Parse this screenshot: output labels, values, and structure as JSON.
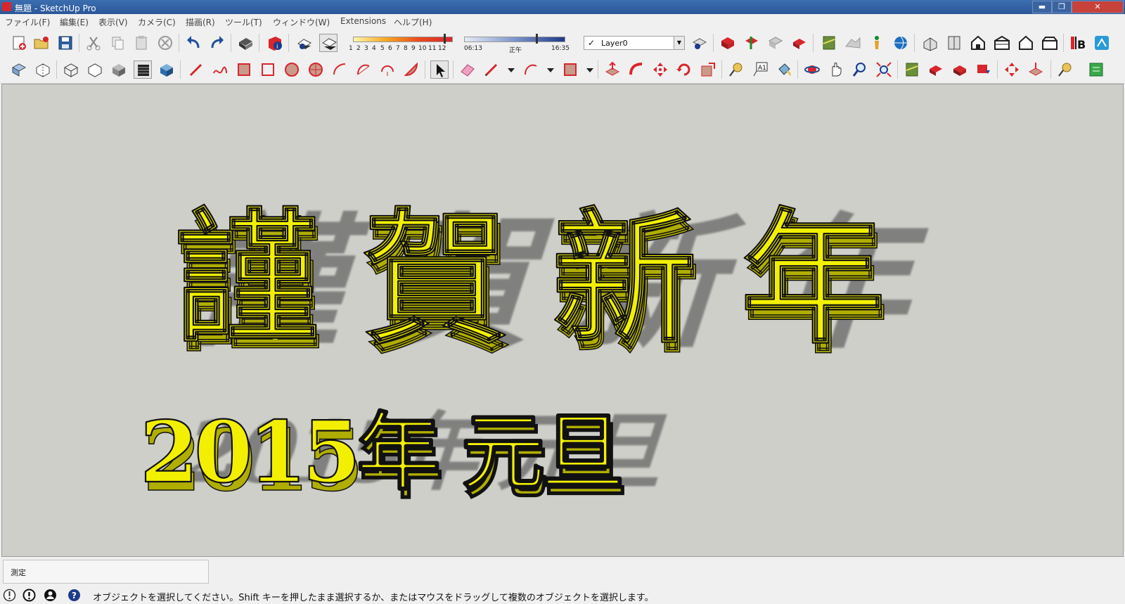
{
  "window": {
    "title": "無題 - SketchUp Pro",
    "controls": {
      "minimize": "▬",
      "restore": "❐",
      "close": "✕"
    }
  },
  "menubar": {
    "items": [
      "ファイル(F)",
      "編集(E)",
      "表示(V)",
      "カメラ(C)",
      "描画(R)",
      "ツール(T)",
      "ウィンドウ(W)",
      "Extensions",
      "ヘルプ(H)"
    ]
  },
  "toolbar": {
    "shadow_ticks": [
      "1",
      "2",
      "3",
      "4",
      "5",
      "6",
      "7",
      "8",
      "9",
      "10",
      "11",
      "12"
    ],
    "shadow_month_level": 0.92,
    "time_start": "06:13",
    "time_mid": "正午",
    "time_end": "16:35",
    "time_level": 0.72,
    "layer_select": {
      "value": "Layer0",
      "checked": "✓"
    },
    "icons_row1": [
      "new-icon",
      "open-icon",
      "save-icon",
      "cut-icon",
      "copy-icon",
      "paste-icon",
      "erase-icon",
      "undo-icon",
      "redo-icon",
      "print-icon",
      "model-info-icon",
      "shadow-toggle-icon",
      "fog-icon",
      "layer-manager-icon",
      "component-icon",
      "section-plane-icon",
      "component-options-icon",
      "share-component-icon",
      "geo-location-icon",
      "person-icon",
      "get-models-icon",
      "iso-view-icon",
      "top-view-icon",
      "front-view-icon",
      "right-view-icon",
      "back-view-icon",
      "left-view-icon",
      "bottom-view-icon",
      "ib-icon",
      "trimble-icon"
    ],
    "icons_row2": [
      "xray-icon",
      "back-edges-icon",
      "wireframe-icon",
      "hidden-line-icon",
      "shaded-icon",
      "shaded-textures-icon",
      "monochrome-icon",
      "line-icon",
      "freehand-icon",
      "rectangle-icon",
      "rotated-rect-icon",
      "circle-icon",
      "polygon-icon",
      "arc-icon",
      "two-point-arc-icon",
      "three-point-arc-icon",
      "pie-icon",
      "select-icon",
      "eraser-icon",
      "pencil-dropdown-icon",
      "arc-dropdown-icon",
      "shape-dropdown-icon",
      "push-pull-icon",
      "follow-me-icon",
      "move-icon",
      "rotate-icon",
      "scale-icon",
      "tape-measure-icon",
      "text-icon",
      "paint-bucket-icon",
      "orbit-icon",
      "pan-icon",
      "zoom-icon",
      "zoom-extents-icon",
      "previous-view-icon",
      "next-view-icon",
      "add-location-icon",
      "terrain-icon",
      "photo-texture-icon",
      "walk-icon",
      "position-camera-icon",
      "warehouse-icon"
    ]
  },
  "canvas": {
    "background": "#cfcfca",
    "text_color": "#f2f000",
    "shadow_color": "#7a7a78",
    "line1": "謹賀新年",
    "line2": "2015年 元旦"
  },
  "measurements": {
    "label": "測定",
    "value": ""
  },
  "statusbar": {
    "icons": [
      "geo-location-icon",
      "credits-icon",
      "user-account-icon",
      "help-icon"
    ],
    "message": "オブジェクトを選択してください。Shift キーを押したまま選択するか、またはマウスをドラッグして複数のオブジェクトを選択します。"
  }
}
